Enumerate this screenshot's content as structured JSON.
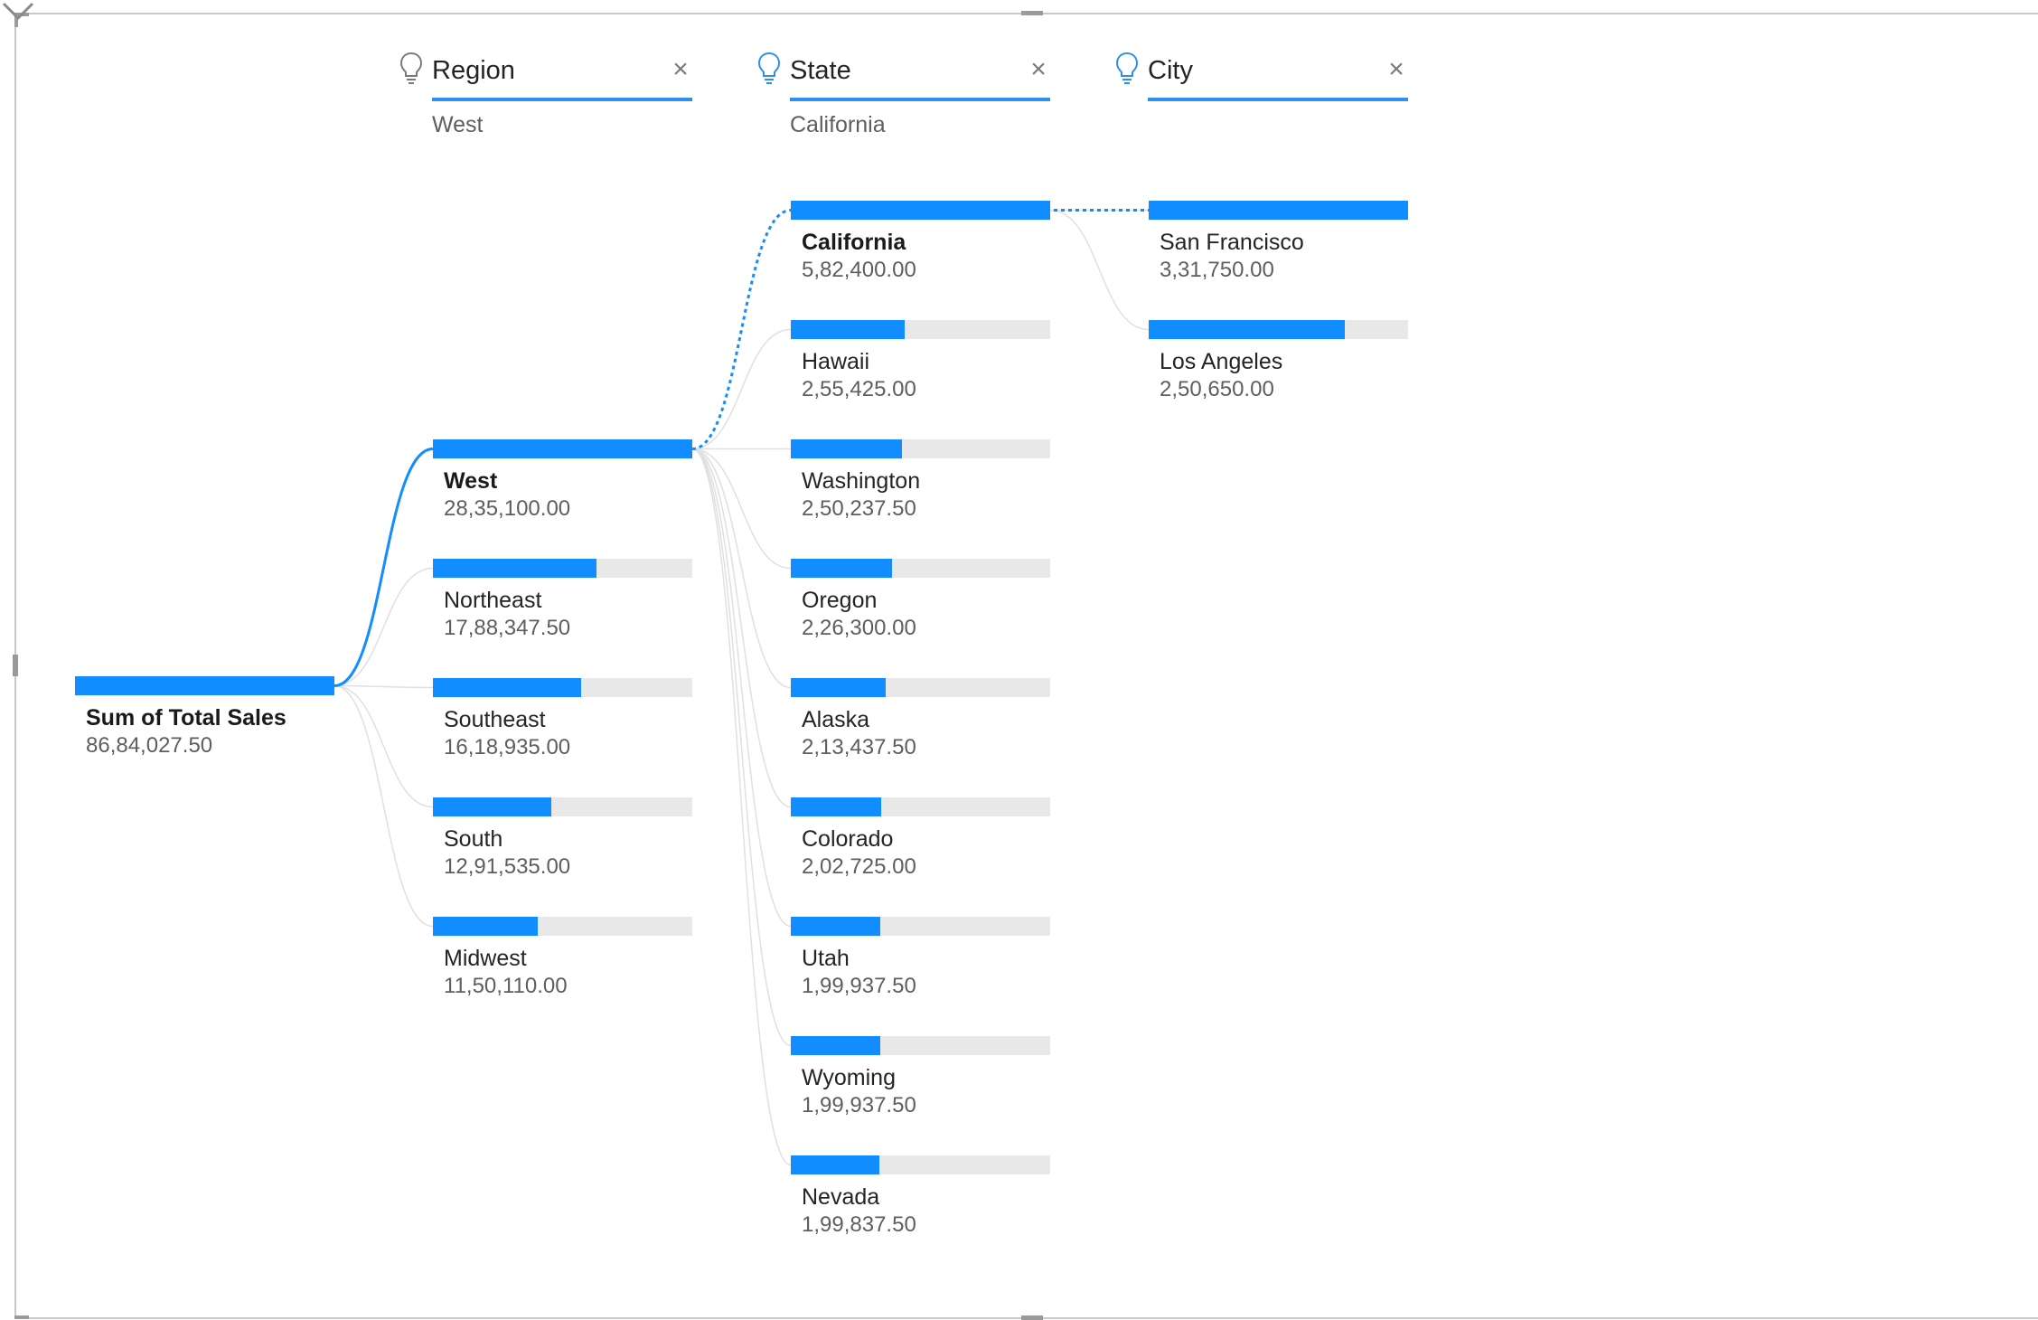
{
  "columns": [
    {
      "title": "Region",
      "selected": "West"
    },
    {
      "title": "State",
      "selected": "California"
    },
    {
      "title": "City",
      "selected": ""
    }
  ],
  "close_glyph": "×",
  "icons": {
    "header": "lightbulb-icon",
    "close": "close-icon",
    "expand": "chevron-down-icon"
  },
  "colors": {
    "bar": "#118dff",
    "track": "#e8e8e8",
    "selected_link": "#118dff",
    "link": "#e0e0e0"
  },
  "chart_data": {
    "type": "decomposition-tree",
    "title": "",
    "root": {
      "label": "Sum of Total Sales",
      "value": 8684027.5,
      "display": "86,84,027.50"
    },
    "levels": [
      {
        "name": "Region",
        "nodes": [
          {
            "label": "West",
            "value": 2835100.0,
            "display": "28,35,100.00",
            "selected": true
          },
          {
            "label": "Northeast",
            "value": 1788347.5,
            "display": "17,88,347.50"
          },
          {
            "label": "Southeast",
            "value": 1618935.0,
            "display": "16,18,935.00"
          },
          {
            "label": "South",
            "value": 1291535.0,
            "display": "12,91,535.00"
          },
          {
            "label": "Midwest",
            "value": 1150110.0,
            "display": "11,50,110.00"
          }
        ]
      },
      {
        "name": "State",
        "nodes": [
          {
            "label": "California",
            "value": 582400.0,
            "display": "5,82,400.00",
            "selected": true
          },
          {
            "label": "Hawaii",
            "value": 255425.0,
            "display": "2,55,425.00"
          },
          {
            "label": "Washington",
            "value": 250237.5,
            "display": "2,50,237.50"
          },
          {
            "label": "Oregon",
            "value": 226300.0,
            "display": "2,26,300.00"
          },
          {
            "label": "Alaska",
            "value": 213437.5,
            "display": "2,13,437.50"
          },
          {
            "label": "Colorado",
            "value": 202725.0,
            "display": "2,02,725.00"
          },
          {
            "label": "Utah",
            "value": 199937.5,
            "display": "1,99,937.50"
          },
          {
            "label": "Wyoming",
            "value": 199937.5,
            "display": "1,99,937.50"
          },
          {
            "label": "Nevada",
            "value": 199837.5,
            "display": "1,99,837.50"
          }
        ]
      },
      {
        "name": "City",
        "nodes": [
          {
            "label": "San Francisco",
            "value": 331750.0,
            "display": "3,31,750.00"
          },
          {
            "label": "Los Angeles",
            "value": 250650.0,
            "display": "2,50,650.00"
          }
        ]
      }
    ]
  }
}
